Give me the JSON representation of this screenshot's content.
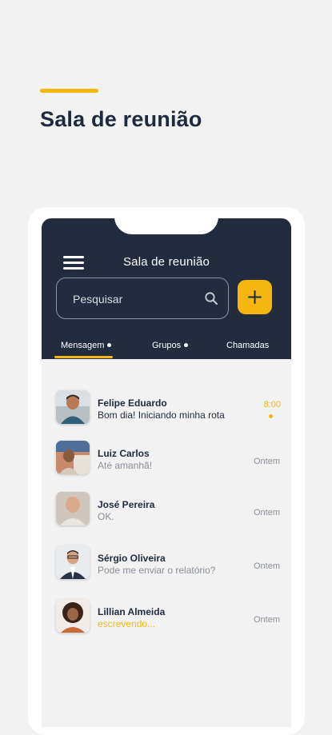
{
  "page": {
    "title": "Sala de reunião"
  },
  "colors": {
    "accent": "#f5b70f",
    "header": "#222c3e",
    "text": "#1e2a3d",
    "muted": "#8a8f98"
  },
  "app": {
    "header_title": "Sala de reunião",
    "search": {
      "placeholder": "Pesquisar",
      "value": ""
    },
    "icons": {
      "menu": "hamburger-menu-icon",
      "search": "search-icon",
      "add": "plus-icon"
    },
    "tabs": [
      {
        "label": "Mensagem",
        "has_dot": true,
        "active": true
      },
      {
        "label": "Grupos",
        "has_dot": true,
        "active": false
      },
      {
        "label": "Chamadas",
        "has_dot": false,
        "active": false
      }
    ],
    "chats": [
      {
        "name": "Felipe Eduardo",
        "message": "Bom dia! Iniciando minha rota",
        "time": "8:00",
        "unread": true,
        "typing": false
      },
      {
        "name": "Luiz Carlos",
        "message": "Até amanhã!",
        "time": "Ontem",
        "unread": false,
        "typing": false
      },
      {
        "name": "José Pereira",
        "message": "OK.",
        "time": "Ontem",
        "unread": false,
        "typing": false
      },
      {
        "name": "Sérgio Oliveira",
        "message": "Pode me enviar o relatório?",
        "time": "Ontem",
        "unread": false,
        "typing": false
      },
      {
        "name": "Lillian Almeida",
        "message": "escrevendo...",
        "time": "Ontem",
        "unread": false,
        "typing": true
      }
    ]
  }
}
